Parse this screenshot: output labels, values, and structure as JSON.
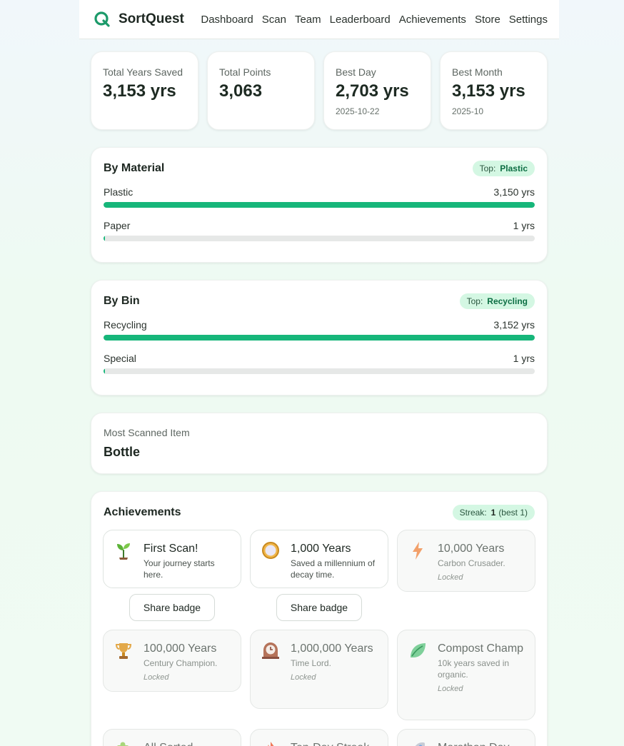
{
  "app": {
    "name": "SortQuest"
  },
  "nav": [
    "Dashboard",
    "Scan",
    "Team",
    "Leaderboard",
    "Achievements",
    "Store",
    "Settings"
  ],
  "stats": [
    {
      "label": "Total Years Saved",
      "value": "3,153 yrs",
      "sub": ""
    },
    {
      "label": "Total Points",
      "value": "3,063",
      "sub": ""
    },
    {
      "label": "Best Day",
      "value": "2,703 yrs",
      "sub": "2025-10-22"
    },
    {
      "label": "Best Month",
      "value": "3,153 yrs",
      "sub": "2025-10"
    }
  ],
  "by_material": {
    "title": "By Material",
    "top_label": "Top:",
    "top_value": "Plastic",
    "rows": [
      {
        "name": "Plastic",
        "value": "3,150 yrs",
        "fraction": 1.0
      },
      {
        "name": "Paper",
        "value": "1 yrs",
        "fraction": 0.0003
      }
    ]
  },
  "by_bin": {
    "title": "By Bin",
    "top_label": "Top:",
    "top_value": "Recycling",
    "rows": [
      {
        "name": "Recycling",
        "value": "3,152 yrs",
        "fraction": 1.0
      },
      {
        "name": "Special",
        "value": "1 yrs",
        "fraction": 0.0003
      }
    ]
  },
  "most_scanned": {
    "label": "Most Scanned Item",
    "value": "Bottle"
  },
  "achievements": {
    "title": "Achievements",
    "streak_label": "Streak:",
    "streak_value": "1",
    "streak_best": "(best 1)",
    "share_label": "Share badge",
    "locked_label": "Locked",
    "badges": [
      {
        "title": "First Scan!",
        "desc": "Your journey starts here.",
        "locked": false,
        "icon": "seedling-icon"
      },
      {
        "title": "1,000 Years",
        "desc": "Saved a millennium of decay time.",
        "locked": false,
        "icon": "compass-icon"
      },
      {
        "title": "10,000 Years",
        "desc": "Carbon Crusader.",
        "locked": true,
        "icon": "lightning-icon"
      },
      {
        "title": "100,000 Years",
        "desc": "Century Champion.",
        "locked": true,
        "icon": "trophy-icon"
      },
      {
        "title": "1,000,000 Years",
        "desc": "Time Lord.",
        "locked": true,
        "icon": "clock-icon"
      },
      {
        "title": "Compost Champ",
        "desc": "10k years saved in organic.",
        "locked": true,
        "icon": "leaf-icon"
      },
      {
        "title": "All Sorted",
        "desc": "",
        "locked": true,
        "icon": "puzzle-icon"
      },
      {
        "title": "Ten-Day Streak",
        "desc": "",
        "locked": true,
        "icon": "flame-icon"
      },
      {
        "title": "Marathon Day",
        "desc": "",
        "locked": true,
        "icon": "rocket-icon"
      }
    ]
  },
  "colors": {
    "accent": "#16b67a",
    "pill_bg": "#d4f7e3",
    "pill_text": "#0c6e43"
  }
}
